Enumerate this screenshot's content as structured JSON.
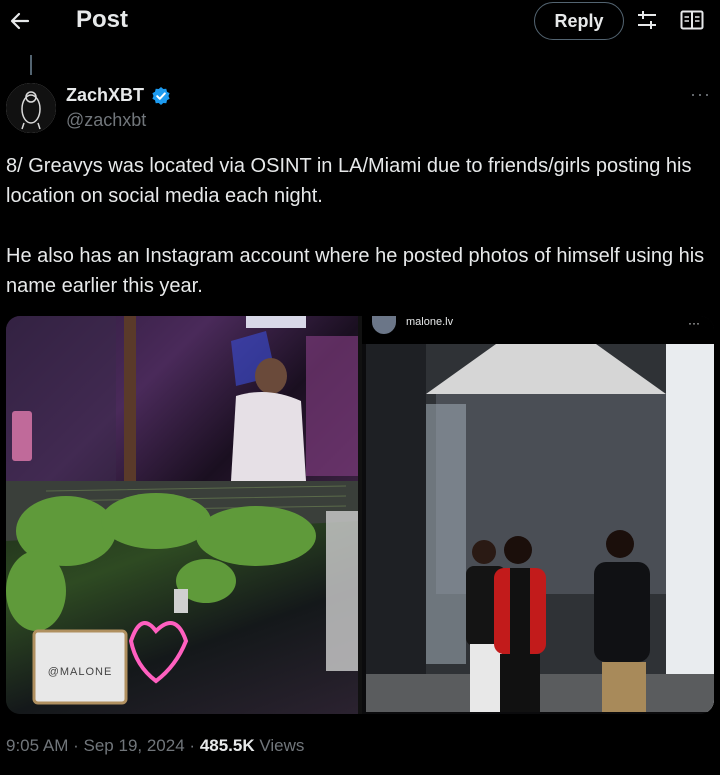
{
  "header": {
    "title": "Post",
    "reply_label": "Reply"
  },
  "post": {
    "author": {
      "name": "ZachXBT",
      "handle": "@zachxbt",
      "verified": true
    },
    "paragraphs": [
      "8/ Greavys was located via OSINT in LA/Miami due to friends/girls posting his location on social media each night.",
      "He also has an Instagram account where he posted photos of himself using his name earlier this year."
    ],
    "media": {
      "left_top_alt": "",
      "left_bottom_sign": "@MALONE",
      "instagram": {
        "username": "malone.lv",
        "more": "···"
      }
    },
    "meta": {
      "time": "9:05 AM",
      "separator": "·",
      "date": "Sep 19, 2024",
      "views_count": "485.5K",
      "views_label": "Views"
    }
  },
  "icons": {
    "back": "arrow-left-icon",
    "sliders": "sliders-icon",
    "reader": "book-open-icon",
    "more": "ellipsis-icon",
    "verified": "verified-badge-icon"
  },
  "colors": {
    "background": "#000000",
    "text": "#e7e9ea",
    "muted": "#71767b",
    "verified": "#1d9bf0",
    "border": "#536471"
  }
}
